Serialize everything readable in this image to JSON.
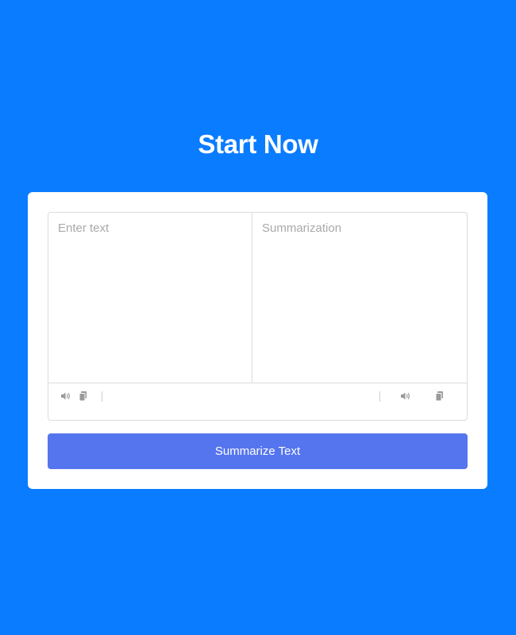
{
  "page": {
    "heading": "Start Now"
  },
  "editor": {
    "input": {
      "placeholder": "Enter text",
      "value": ""
    },
    "output": {
      "placeholder": "Summarization",
      "value": ""
    },
    "toolbar": {
      "left_icons": [
        "speaker-icon",
        "copy-icon"
      ],
      "right_icons": [
        "speaker-icon",
        "copy-icon"
      ]
    }
  },
  "actions": {
    "summarize_label": "Summarize Text"
  },
  "colors": {
    "background": "#0a7cff",
    "card": "#ffffff",
    "button": "#5575ef",
    "icon": "#9a9a9a",
    "border": "#dcdcdc"
  }
}
